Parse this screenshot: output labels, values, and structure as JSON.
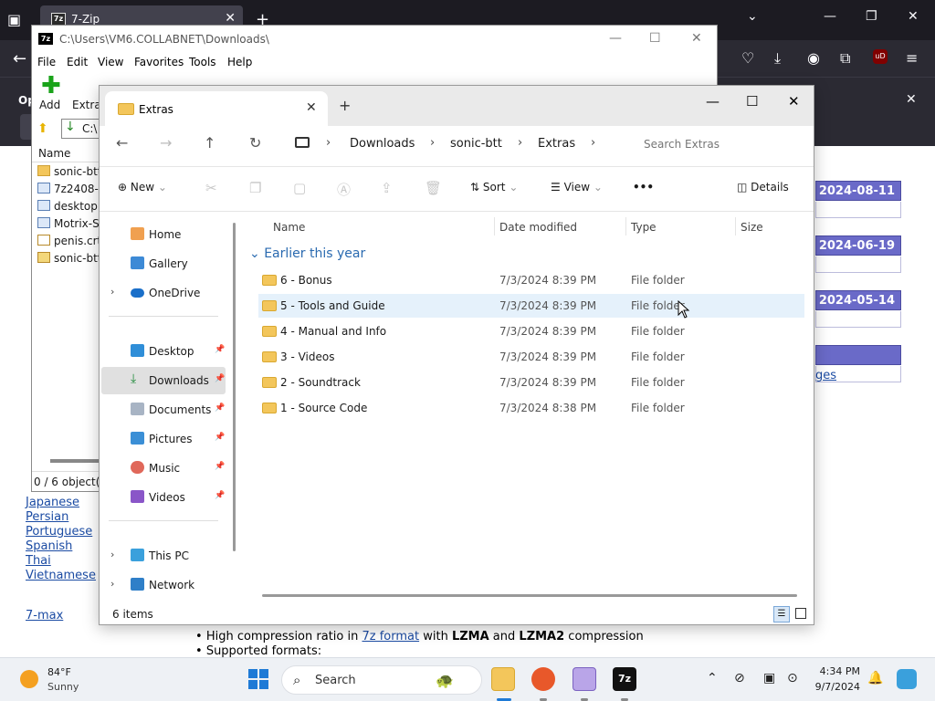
{
  "firefox": {
    "tab_title": "7-Zip",
    "tab_favicon": "7z",
    "notification_text": "Op",
    "ublock_label": "uD"
  },
  "sevenzip": {
    "title_icon": "7z",
    "path": "C:\\Users\\VM6.COLLABNET\\Downloads\\",
    "menu": [
      "File",
      "Edit",
      "View",
      "Favorites",
      "Tools",
      "Help"
    ],
    "toolbar": {
      "add": "Add",
      "extract": "Extrac"
    },
    "address": "C:\\",
    "col_name": "Name",
    "files": [
      {
        "name": "sonic-btt",
        "icon": "folder"
      },
      {
        "name": "7z2408-x6",
        "icon": "exe"
      },
      {
        "name": "desktop.i",
        "icon": "ini"
      },
      {
        "name": "Motrix-Se",
        "icon": "exe"
      },
      {
        "name": "penis.crt",
        "icon": "cert"
      },
      {
        "name": "sonic-btt.",
        "icon": "zip"
      }
    ],
    "status": "0 / 6 object(s)"
  },
  "page": {
    "languages": [
      "Japanese",
      "Persian",
      "Portuguese",
      "Spanish",
      "Thai",
      "Vietnamese"
    ],
    "max_link": "7-max",
    "dates": [
      "2024-08-11",
      "2024-06-19",
      "2024-05-14"
    ],
    "ges_link": "ges",
    "bullet1_pre": "High compression ratio in ",
    "bullet1_link": "7z format",
    "bullet1_mid": " with ",
    "bullet1_b1": "LZMA",
    "bullet1_and": " and ",
    "bullet1_b2": "LZMA2",
    "bullet1_post": " compression",
    "bullet2": "Supported formats:"
  },
  "explorer": {
    "tab_title": "Extras",
    "breadcrumbs": [
      "Downloads",
      "sonic-btt",
      "Extras"
    ],
    "search_placeholder": "Search Extras",
    "cmd": {
      "new": "New",
      "sort": "Sort",
      "view": "View",
      "more": "•••",
      "details": "Details"
    },
    "nav": [
      {
        "label": "Home"
      },
      {
        "label": "Gallery"
      },
      {
        "label": "OneDrive"
      },
      {
        "label": "Desktop"
      },
      {
        "label": "Downloads"
      },
      {
        "label": "Documents"
      },
      {
        "label": "Pictures"
      },
      {
        "label": "Music"
      },
      {
        "label": "Videos"
      },
      {
        "label": "This PC"
      },
      {
        "label": "Network"
      }
    ],
    "columns": {
      "name": "Name",
      "date": "Date modified",
      "type": "Type",
      "size": "Size"
    },
    "group": "Earlier this year",
    "rows": [
      {
        "name": "6 - Bonus",
        "date": "7/3/2024 8:39 PM",
        "type": "File folder"
      },
      {
        "name": "5 - Tools and Guide",
        "date": "7/3/2024 8:39 PM",
        "type": "File folder"
      },
      {
        "name": "4 - Manual and Info",
        "date": "7/3/2024 8:39 PM",
        "type": "File folder"
      },
      {
        "name": "3 - Videos",
        "date": "7/3/2024 8:39 PM",
        "type": "File folder"
      },
      {
        "name": "2 - Soundtrack",
        "date": "7/3/2024 8:39 PM",
        "type": "File folder"
      },
      {
        "name": "1 - Source Code",
        "date": "7/3/2024 8:38 PM",
        "type": "File folder"
      }
    ],
    "status": "6 items"
  },
  "taskbar": {
    "temp": "84°F",
    "condition": "Sunny",
    "search_label": "Search",
    "time": "4:34 PM",
    "date": "9/7/2024",
    "sevenzip_label": "7z"
  }
}
